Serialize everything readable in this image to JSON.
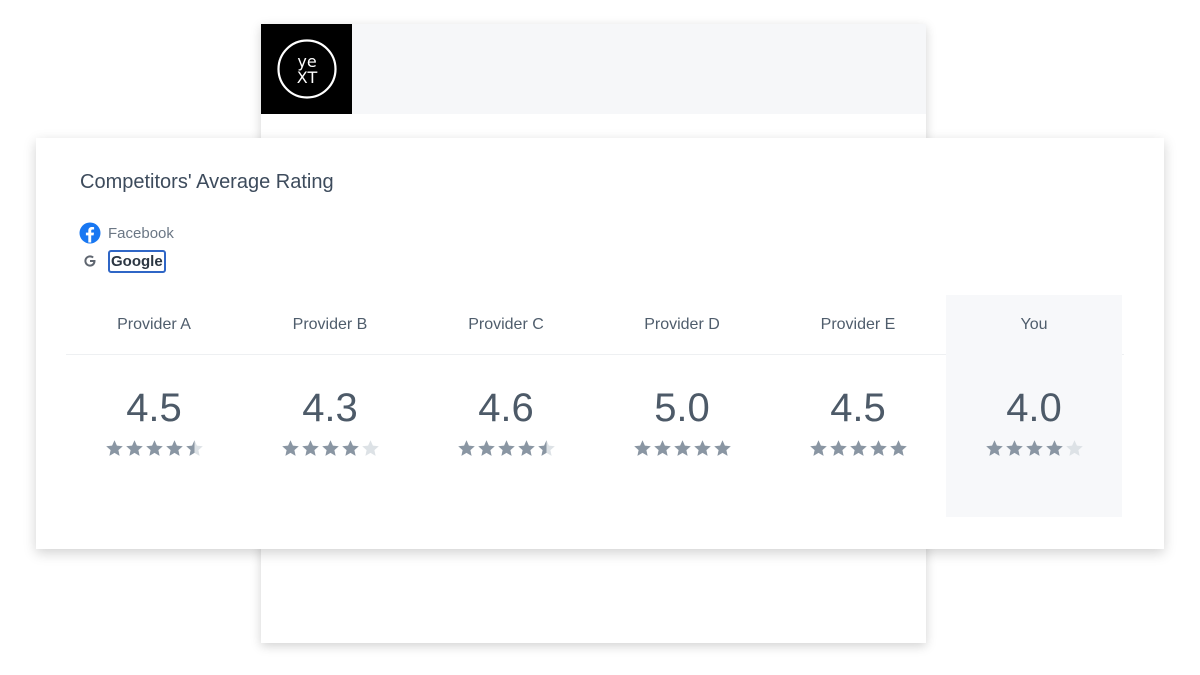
{
  "background_panel": {
    "logo_text_top": "ye",
    "logo_text_bottom": "XT",
    "logo_alt": "Yext"
  },
  "card": {
    "title": "Competitors' Average Rating",
    "sources": [
      {
        "name": "Facebook",
        "icon": "facebook-icon",
        "selected": false
      },
      {
        "name": "Google",
        "icon": "google-icon",
        "selected": true
      }
    ],
    "columns": [
      {
        "label": "Provider A",
        "rating": "4.5",
        "stars": 4.5,
        "highlight": false
      },
      {
        "label": "Provider B",
        "rating": "4.3",
        "stars": 4,
        "highlight": false
      },
      {
        "label": "Provider C",
        "rating": "4.6",
        "stars": 4.5,
        "highlight": false
      },
      {
        "label": "Provider D",
        "rating": "5.0",
        "stars": 5,
        "highlight": false
      },
      {
        "label": "Provider E",
        "rating": "4.5",
        "stars": 5,
        "highlight": false
      },
      {
        "label": "You",
        "rating": "4.0",
        "stars": 4,
        "highlight": true
      }
    ],
    "colors": {
      "star_filled": "#8a96a3",
      "star_empty": "#dde2e6",
      "facebook": "#1877f2",
      "selected_border": "#2f66c6"
    }
  }
}
